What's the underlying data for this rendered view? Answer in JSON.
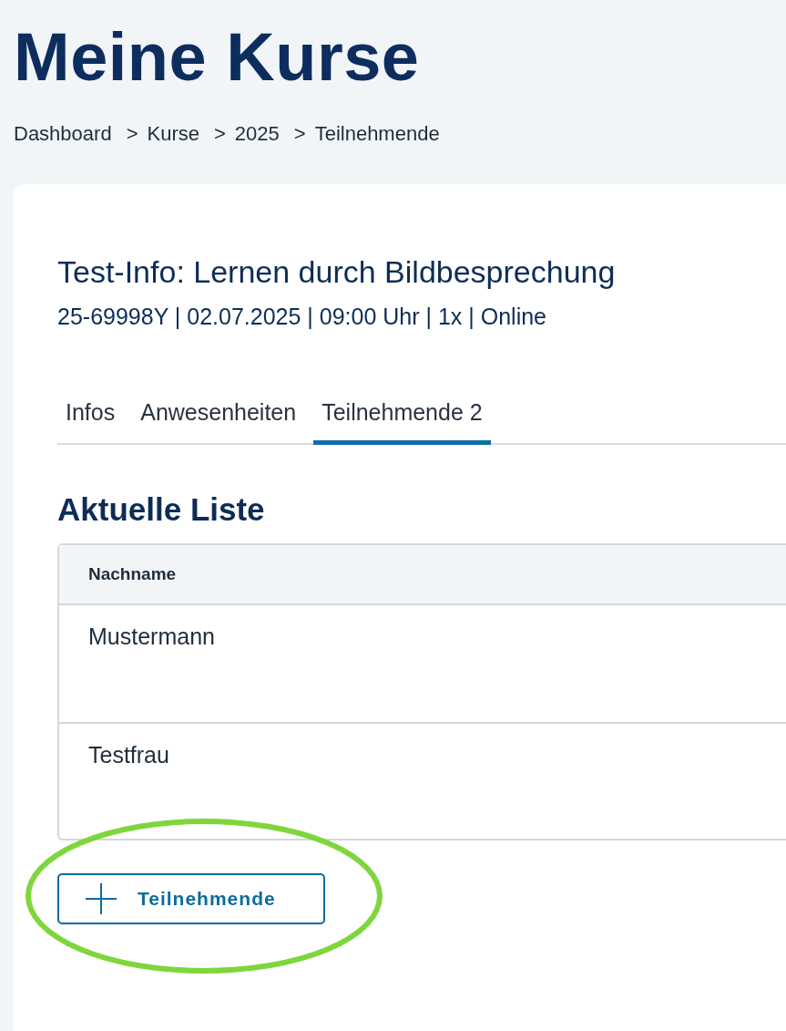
{
  "page_title": "Meine Kurse",
  "breadcrumb": {
    "separator": ">",
    "items": [
      {
        "label": "Dashboard"
      },
      {
        "label": "Kurse"
      },
      {
        "label": "2025"
      },
      {
        "label": "Teilnehmende"
      }
    ]
  },
  "course": {
    "title": "Test-Info: Lernen durch Bildbesprechung",
    "meta": "25-69998Y | 02.07.2025 | 09:00 Uhr | 1x | Online"
  },
  "tabs": [
    {
      "label": "Infos",
      "selected": false
    },
    {
      "label": "Anwesenheiten",
      "selected": false
    },
    {
      "label": "Teilnehmende 2",
      "selected": true
    }
  ],
  "list": {
    "heading": "Aktuelle Liste",
    "columns": [
      "Nachname"
    ],
    "rows": [
      [
        "Mustermann"
      ],
      [
        "Testfrau"
      ]
    ]
  },
  "add_button": {
    "label": "Teilnehmende",
    "highlighted": true
  }
}
